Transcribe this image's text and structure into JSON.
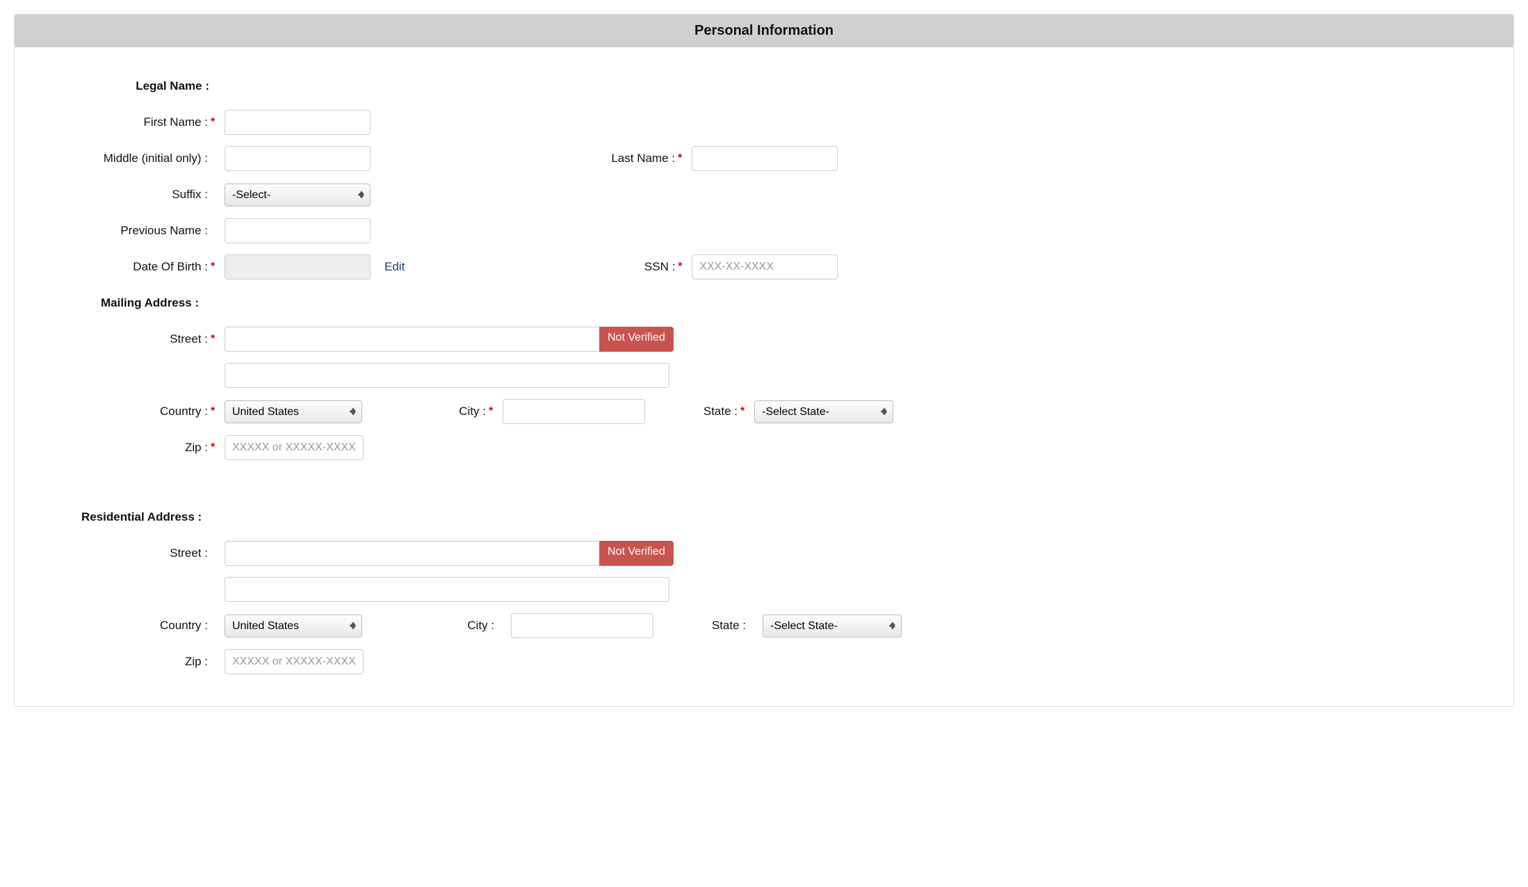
{
  "panel": {
    "title": "Personal Information"
  },
  "sections": {
    "legalName": "Legal Name :",
    "mailingAddress": "Mailing Address :",
    "residentialAddress": "Residential Address :"
  },
  "labels": {
    "firstName": "First Name :",
    "middle": "Middle (initial only) :",
    "lastName": "Last Name :",
    "suffix": "Suffix :",
    "previousName": "Previous Name :",
    "dob": "Date Of Birth :",
    "ssn": "SSN :",
    "street": "Street :",
    "country": "Country :",
    "city": "City :",
    "state": "State :",
    "zip": "Zip :",
    "edit": "Edit"
  },
  "placeholders": {
    "ssn": "XXX-XX-XXXX",
    "zip": "XXXXX or XXXXX-XXXX"
  },
  "selects": {
    "suffix": "-Select-",
    "country": "United States",
    "state": "-Select State-"
  },
  "badges": {
    "notVerified": "Not Verified"
  },
  "values": {
    "firstName": "",
    "middle": "",
    "lastName": "",
    "previousName": "",
    "dob": "",
    "ssn": "",
    "mailing": {
      "street1": "",
      "street2": "",
      "city": "",
      "zip": ""
    },
    "residential": {
      "street1": "",
      "street2": "",
      "city": "",
      "zip": ""
    }
  },
  "requiredMark": "*"
}
